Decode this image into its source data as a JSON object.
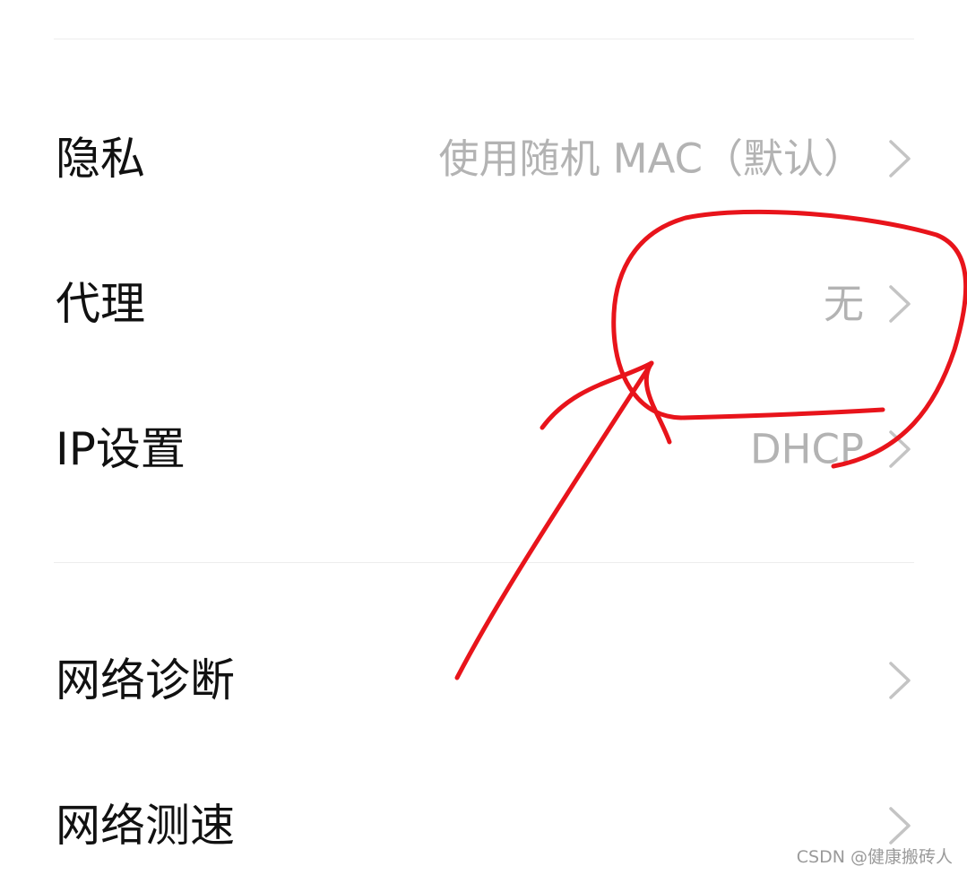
{
  "settings": {
    "rows": [
      {
        "label": "隐私",
        "value": "使用随机 MAC（默认）",
        "icon": "chevron-right-icon"
      },
      {
        "label": "代理",
        "value": "无",
        "icon": "chevron-right-icon"
      },
      {
        "label": "IP设置",
        "value": "DHCP",
        "icon": "chevron-right-icon"
      },
      {
        "label": "网络诊断",
        "value": "",
        "icon": "chevron-right-icon"
      },
      {
        "label": "网络测速",
        "value": "",
        "icon": "chevron-right-icon"
      }
    ]
  },
  "annotation": {
    "color": "#e8141b"
  },
  "watermark": {
    "text": "CSDN @健康搬砖人"
  },
  "colors": {
    "label": "#111111",
    "value": "#b3b3b3",
    "chevron": "#c4c4c4",
    "divider": "#ededed"
  }
}
